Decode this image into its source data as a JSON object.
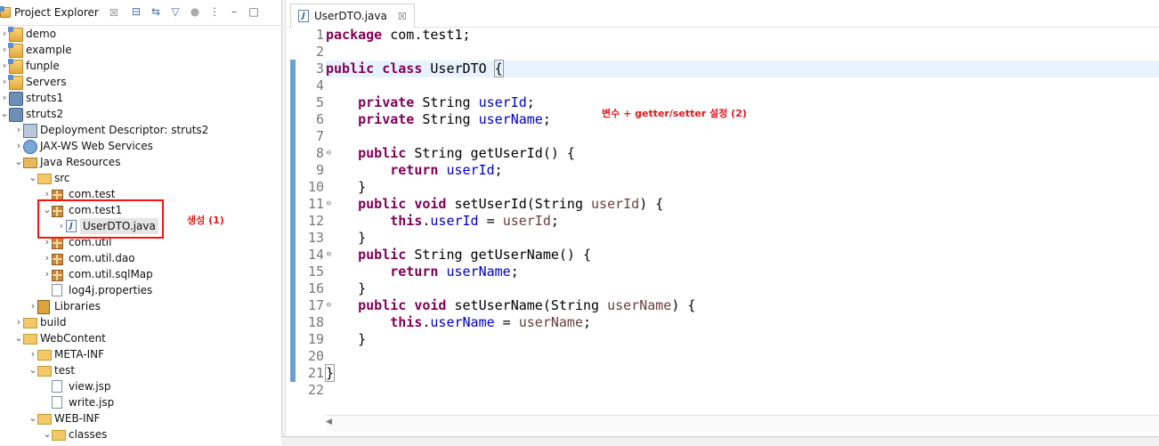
{
  "explorer": {
    "title": "Project Explorer",
    "close": "☒",
    "tree": [
      {
        "label": "demo",
        "depth": 0,
        "twisty": "›",
        "icon": "proj"
      },
      {
        "label": "example",
        "depth": 0,
        "twisty": "›",
        "icon": "proj"
      },
      {
        "label": "funple",
        "depth": 0,
        "twisty": "›",
        "icon": "proj"
      },
      {
        "label": "Servers",
        "depth": 0,
        "twisty": "›",
        "icon": "proj"
      },
      {
        "label": "struts1",
        "depth": 0,
        "twisty": "›",
        "icon": "srv"
      },
      {
        "label": "struts2",
        "depth": 0,
        "twisty": "⌄",
        "icon": "srv"
      },
      {
        "label": "Deployment Descriptor: struts2",
        "depth": 1,
        "twisty": "›",
        "icon": "dd"
      },
      {
        "label": "JAX-WS Web Services",
        "depth": 1,
        "twisty": "›",
        "icon": "ws"
      },
      {
        "label": "Java Resources",
        "depth": 1,
        "twisty": "⌄",
        "icon": "jres"
      },
      {
        "label": "src",
        "depth": 2,
        "twisty": "⌄",
        "icon": "folder"
      },
      {
        "label": "com.test",
        "depth": 3,
        "twisty": "›",
        "icon": "pkg"
      },
      {
        "label": "com.test1",
        "depth": 3,
        "twisty": "⌄",
        "icon": "pkg"
      },
      {
        "label": "UserDTO.java",
        "depth": 4,
        "twisty": "›",
        "icon": "jfile",
        "selected": true
      },
      {
        "label": "com.util",
        "depth": 3,
        "twisty": "›",
        "icon": "pkg"
      },
      {
        "label": "com.util.dao",
        "depth": 3,
        "twisty": "›",
        "icon": "pkg"
      },
      {
        "label": "com.util.sqlMap",
        "depth": 3,
        "twisty": "›",
        "icon": "pkg"
      },
      {
        "label": "log4j.properties",
        "depth": 3,
        "twisty": "",
        "icon": "file"
      },
      {
        "label": "Libraries",
        "depth": 2,
        "twisty": "›",
        "icon": "lib"
      },
      {
        "label": "build",
        "depth": 1,
        "twisty": "›",
        "icon": "folder"
      },
      {
        "label": "WebContent",
        "depth": 1,
        "twisty": "⌄",
        "icon": "folder"
      },
      {
        "label": "META-INF",
        "depth": 2,
        "twisty": "›",
        "icon": "folder"
      },
      {
        "label": "test",
        "depth": 2,
        "twisty": "⌄",
        "icon": "folder"
      },
      {
        "label": "view.jsp",
        "depth": 3,
        "twisty": "",
        "icon": "file"
      },
      {
        "label": "write.jsp",
        "depth": 3,
        "twisty": "",
        "icon": "file"
      },
      {
        "label": "WEB-INF",
        "depth": 2,
        "twisty": "⌄",
        "icon": "folder"
      },
      {
        "label": "classes",
        "depth": 3,
        "twisty": "⌄",
        "icon": "folder"
      }
    ],
    "annotation": "생성 (1)"
  },
  "editor": {
    "tab_label": "UserDTO.java",
    "tab_close": "☒",
    "annotation": "변수 + getter/setter 설정 (2)",
    "lines": [
      {
        "n": "1",
        "fold": "",
        "html": "<span class='kw'>package</span> com.test1;"
      },
      {
        "n": "2",
        "fold": "",
        "html": ""
      },
      {
        "n": "3",
        "fold": "",
        "html": "<span class='kw'>public</span> <span class='kw'>class</span> UserDTO <span class='brace-hl'>{</span><span class='caret'></span>",
        "current": true
      },
      {
        "n": "4",
        "fold": "",
        "html": ""
      },
      {
        "n": "5",
        "fold": "",
        "html": "    <span class='kw'>private</span> String <span class='fld'>userId</span>;"
      },
      {
        "n": "6",
        "fold": "",
        "html": "    <span class='kw'>private</span> String <span class='fld'>userName</span>;"
      },
      {
        "n": "7",
        "fold": "",
        "html": ""
      },
      {
        "n": "8",
        "fold": "⊖",
        "html": "    <span class='kw'>public</span> String getUserId() {"
      },
      {
        "n": "9",
        "fold": "",
        "html": "        <span class='kw'>return</span> <span class='fld'>userId</span>;"
      },
      {
        "n": "10",
        "fold": "",
        "html": "    }"
      },
      {
        "n": "11",
        "fold": "⊖",
        "html": "    <span class='kw'>public</span> <span class='kw'>void</span> setUserId(String <span class='prm'>userId</span>) {"
      },
      {
        "n": "12",
        "fold": "",
        "html": "        <span class='kw'>this</span>.<span class='fld'>userId</span> = <span class='prm'>userId</span>;"
      },
      {
        "n": "13",
        "fold": "",
        "html": "    }"
      },
      {
        "n": "14",
        "fold": "⊖",
        "html": "    <span class='kw'>public</span> String getUserName() {"
      },
      {
        "n": "15",
        "fold": "",
        "html": "        <span class='kw'>return</span> <span class='fld'>userName</span>;"
      },
      {
        "n": "16",
        "fold": "",
        "html": "    }"
      },
      {
        "n": "17",
        "fold": "⊖",
        "html": "    <span class='kw'>public</span> <span class='kw'>void</span> setUserName(String <span class='prm'>userName</span>) {"
      },
      {
        "n": "18",
        "fold": "",
        "html": "        <span class='kw'>this</span>.<span class='fld'>userName</span> = <span class='prm'>userName</span>;"
      },
      {
        "n": "19",
        "fold": "",
        "html": "    }"
      },
      {
        "n": "20",
        "fold": "",
        "html": ""
      },
      {
        "n": "21",
        "fold": "",
        "html": "<span class='brace-hl'>}</span>"
      },
      {
        "n": "22",
        "fold": "",
        "html": ""
      }
    ]
  },
  "colors": {
    "keyword": "#7f0055",
    "field": "#0000c0",
    "param": "#6a3e3e",
    "annotation": "#e4181d"
  }
}
